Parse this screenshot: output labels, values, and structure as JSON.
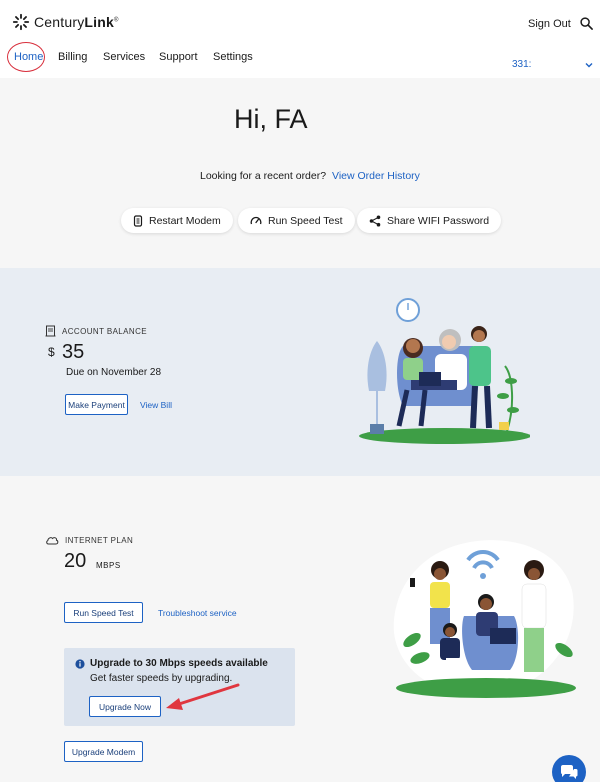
{
  "header": {
    "brand_light": "Century",
    "brand_bold": "Link",
    "sign_out": "Sign Out",
    "account": "331:"
  },
  "nav": {
    "home": "Home",
    "billing": "Billing",
    "services": "Services",
    "support": "Support",
    "settings": "Settings"
  },
  "hero": {
    "greeting": "Hi, FA",
    "recent_text": "Looking for a recent order?",
    "order_history": "View Order History",
    "actions": [
      "Restart Modem",
      "Run Speed Test",
      "Share WIFI Password"
    ]
  },
  "balance": {
    "label": "ACCOUNT BALANCE",
    "currency": "$",
    "amount": "35",
    "due": "Due on November 28",
    "make_payment": "Make Payment",
    "view_bill": "View Bill"
  },
  "internet": {
    "label": "INTERNET PLAN",
    "speed": "20",
    "unit": "MBPS",
    "run_speed_test": "Run Speed Test",
    "troubleshoot": "Troubleshoot service",
    "upgrade_title": "Upgrade to 30 Mbps speeds available",
    "upgrade_sub": "Get faster speeds by upgrading.",
    "upgrade_now": "Upgrade Now",
    "upgrade_modem": "Upgrade Modem"
  },
  "colors": {
    "accent": "#1d62c4",
    "annotation_red": "#d8303d",
    "balance_band": "#e8edf3",
    "upgrade_box": "#dbe3ee"
  }
}
